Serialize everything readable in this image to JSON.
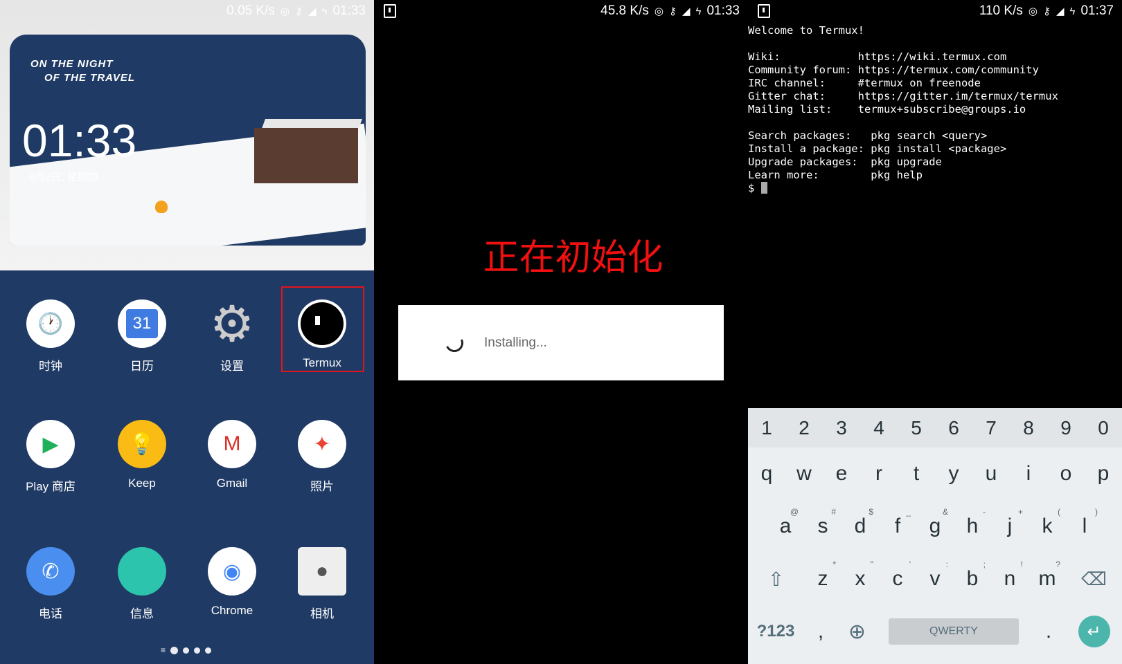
{
  "home": {
    "status": {
      "speed": "0.05 K/s",
      "time": "01:33"
    },
    "wallpaper": {
      "title_line1": "ON THE NIGHT",
      "title_line2": "OF THE TRAVEL",
      "clock": "01:33",
      "date": "8月2日, 星期四"
    },
    "apps": [
      {
        "label": "时钟",
        "icon": "clock-icon"
      },
      {
        "label": "日历",
        "icon": "calendar-icon",
        "badge": "31"
      },
      {
        "label": "设置",
        "icon": "settings-gear-icon"
      },
      {
        "label": "Termux",
        "icon": "termux-icon",
        "highlighted": true
      },
      {
        "label": "Play 商店",
        "icon": "play-store-icon"
      },
      {
        "label": "Keep",
        "icon": "keep-icon"
      },
      {
        "label": "Gmail",
        "icon": "gmail-icon"
      },
      {
        "label": "照片",
        "icon": "photos-icon"
      },
      {
        "label": "电话",
        "icon": "phone-icon"
      },
      {
        "label": "信息",
        "icon": "messages-icon"
      },
      {
        "label": "Chrome",
        "icon": "chrome-icon"
      },
      {
        "label": "相机",
        "icon": "camera-icon"
      }
    ],
    "highlight_color": "#e5141b"
  },
  "installing": {
    "status": {
      "speed": "45.8 K/s",
      "time": "01:33"
    },
    "annotation": "正在初始化",
    "annotation_color": "#f01010",
    "dialog_text": "Installing..."
  },
  "terminal": {
    "status": {
      "speed": "110 K/s",
      "time": "01:37"
    },
    "lines": [
      "Welcome to Termux!",
      "",
      "Wiki:            https://wiki.termux.com",
      "Community forum: https://termux.com/community",
      "IRC channel:     #termux on freenode",
      "Gitter chat:     https://gitter.im/termux/termux",
      "Mailing list:    termux+subscribe@groups.io",
      "",
      "Search packages:   pkg search <query>",
      "Install a package: pkg install <package>",
      "Upgrade packages:  pkg upgrade",
      "Learn more:        pkg help"
    ],
    "prompt": "$ "
  },
  "keyboard": {
    "numbers": [
      "1",
      "2",
      "3",
      "4",
      "5",
      "6",
      "7",
      "8",
      "9",
      "0"
    ],
    "row1": [
      "q",
      "w",
      "e",
      "r",
      "t",
      "y",
      "u",
      "i",
      "o",
      "p"
    ],
    "row2": [
      [
        "a",
        "@"
      ],
      [
        "s",
        "#"
      ],
      [
        "d",
        "$"
      ],
      [
        "f",
        "_"
      ],
      [
        "g",
        "&"
      ],
      [
        "h",
        "-"
      ],
      [
        "j",
        "+"
      ],
      [
        "k",
        "("
      ],
      [
        "l",
        ")"
      ]
    ],
    "row3": [
      [
        "z",
        "*"
      ],
      [
        "x",
        "\""
      ],
      [
        "c",
        "'"
      ],
      [
        "v",
        ":"
      ],
      [
        "b",
        ";"
      ],
      [
        "n",
        "!"
      ],
      [
        "m",
        "?"
      ]
    ],
    "symbols_key": "?123",
    "comma": ",",
    "space_label": "QWERTY",
    "period": ".",
    "accent": "#4db6ac"
  }
}
